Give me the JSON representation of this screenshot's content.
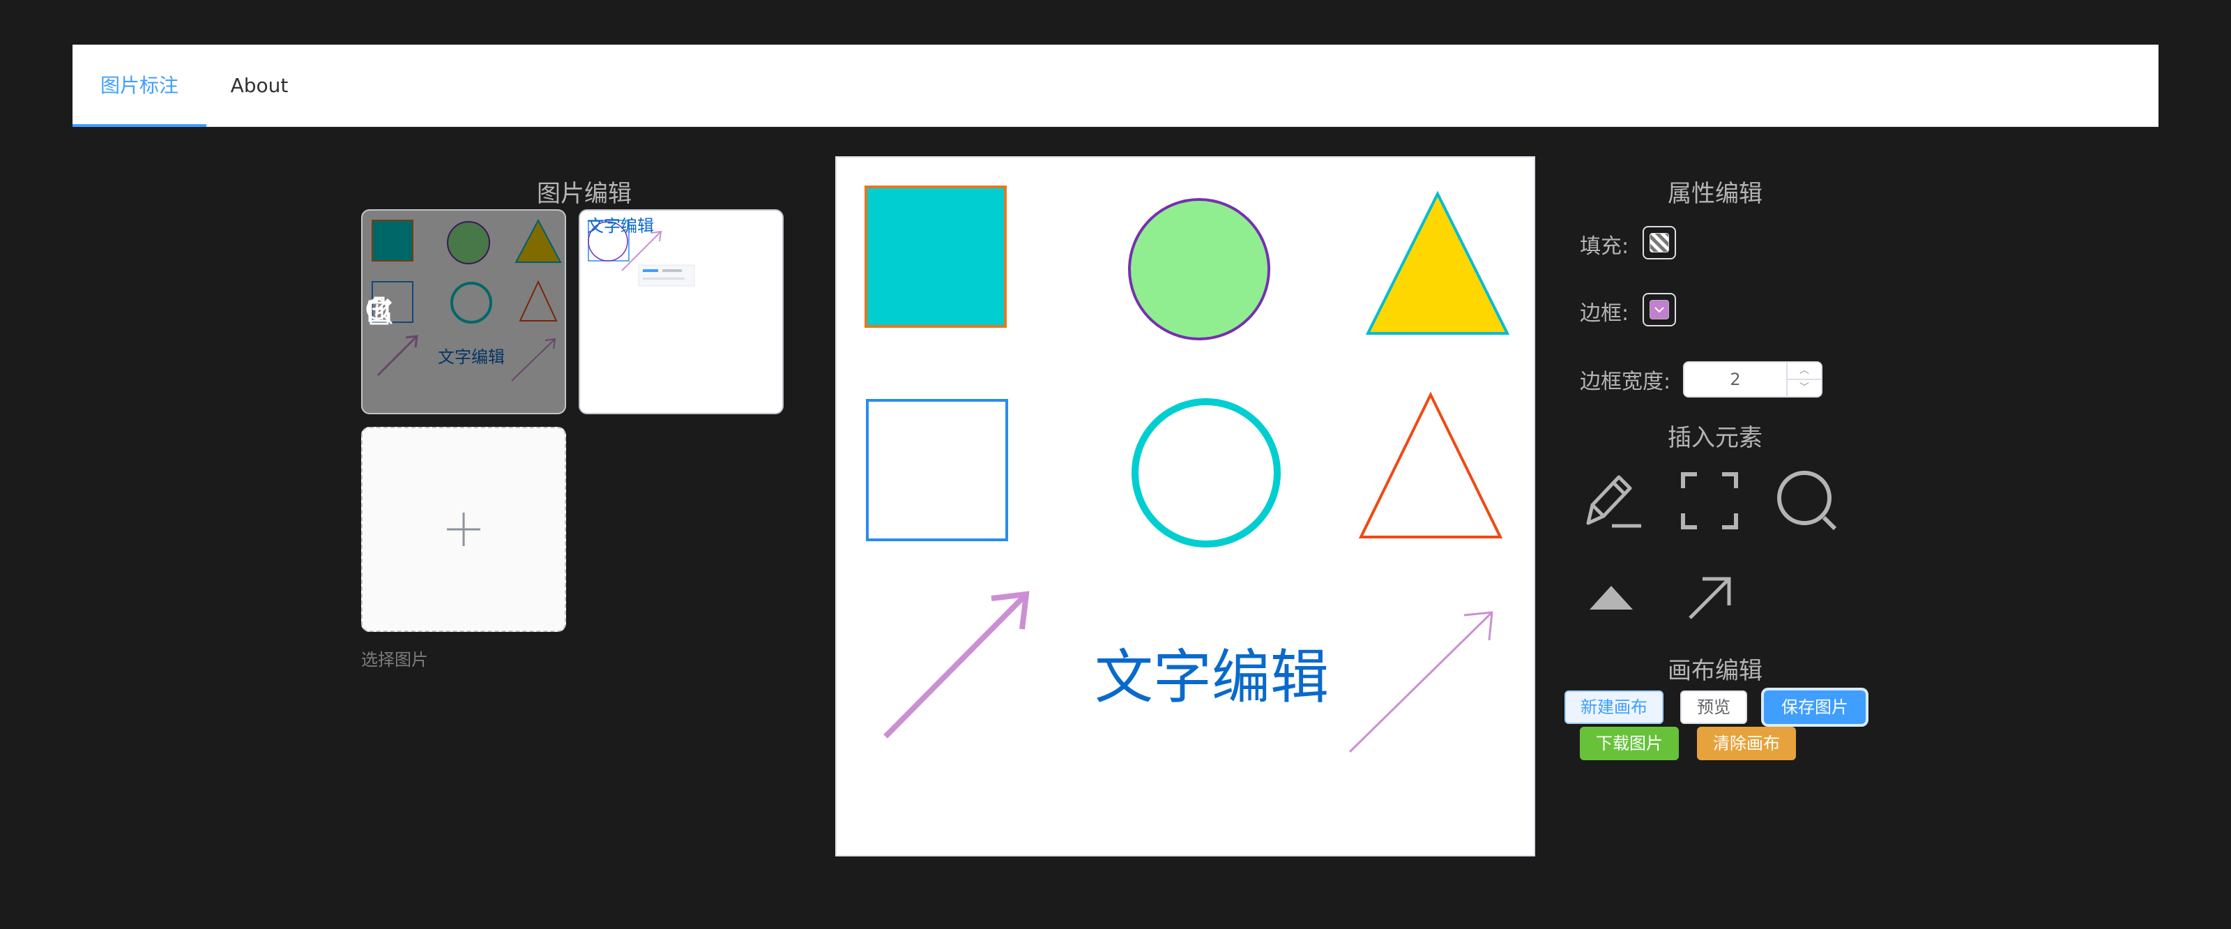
{
  "nav": {
    "tabs": [
      {
        "label": "图片标注",
        "active": true
      },
      {
        "label": "About",
        "active": false
      }
    ],
    "active_color": "#409eff"
  },
  "left_panel": {
    "title": "图片编辑",
    "thumbnails": [
      {
        "overlay_actions": [
          "zoom-in-icon",
          "edit-icon",
          "delete-icon"
        ],
        "text": "文字编辑"
      },
      {
        "text": "文字编辑"
      }
    ],
    "upload_tip": "选择图片"
  },
  "canvas": {
    "text": "文字编辑",
    "shapes": {
      "filled_rect": {
        "fill": "#00ced1",
        "stroke": "#e6781e"
      },
      "filled_circle": {
        "fill": "#90ee90",
        "stroke": "#7630b0"
      },
      "filled_triangle": {
        "fill": "#ffd700",
        "stroke": "#00bcd4"
      },
      "outline_rect": {
        "stroke": "#2a8cf0"
      },
      "outline_circle": {
        "stroke": "#00ced1"
      },
      "outline_triangle": {
        "stroke": "#ef4a14"
      },
      "arrow_thick": {
        "stroke": "#cc8fd3"
      },
      "arrow_thin": {
        "stroke": "#cc8fd3"
      }
    },
    "text_color": "#0a6acb"
  },
  "right_panel": {
    "title": "属性编辑",
    "fill_label": "填充:",
    "stroke_label": "边框:",
    "stroke_color": "#c27fcf",
    "stroke_width_label": "边框宽度:",
    "stroke_width_value": "2",
    "insert_title": "插入元素",
    "tools": [
      "pencil-icon",
      "fullscreen-frame-icon",
      "search-circle-icon",
      "triangle-icon",
      "arrow-icon"
    ],
    "canvas_title": "画布编辑",
    "buttons": {
      "new": "新建画布",
      "preview": "预览",
      "save": "保存图片",
      "download": "下载图片",
      "clear": "清除画布"
    }
  }
}
